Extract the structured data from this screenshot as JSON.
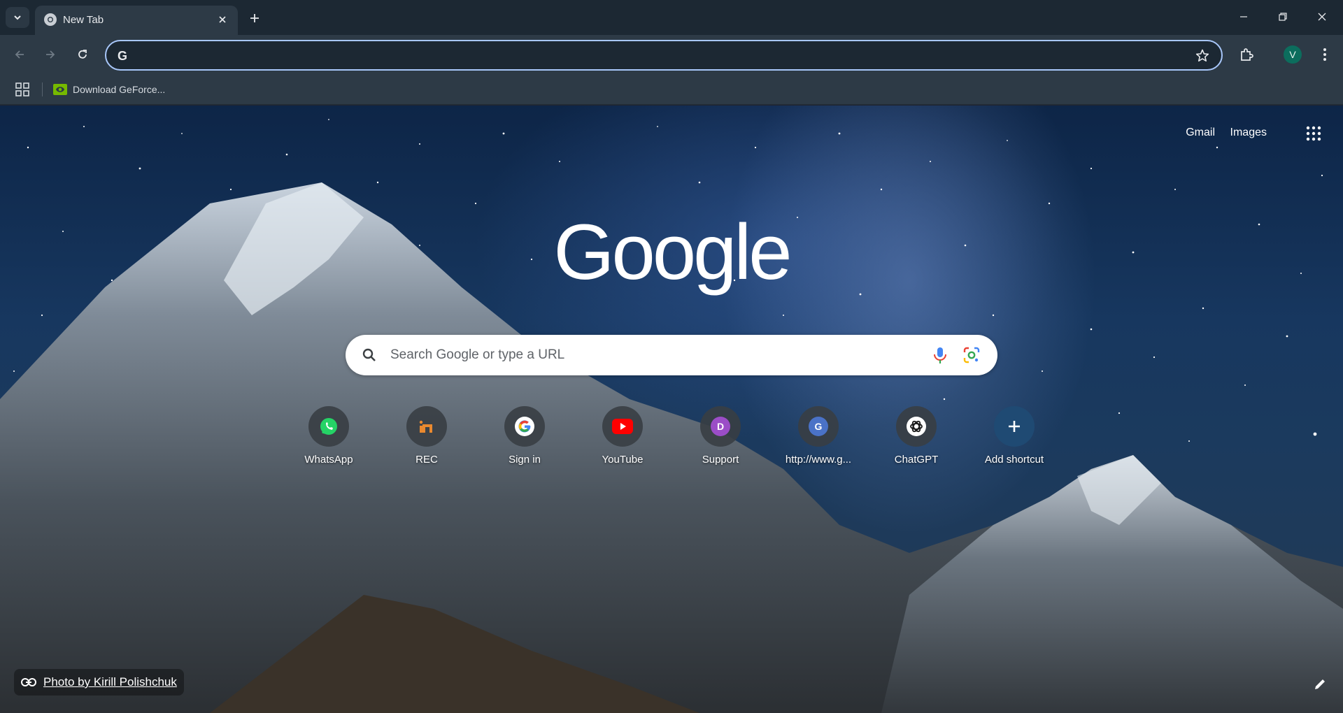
{
  "browser": {
    "tab": {
      "title": "New Tab"
    },
    "omnibox": {
      "value": "",
      "placeholder": ""
    },
    "profile": {
      "initial": "V"
    },
    "bookmarks": [
      {
        "label": "Download GeForce..."
      }
    ]
  },
  "ntp": {
    "top_links": {
      "gmail": "Gmail",
      "images": "Images"
    },
    "search": {
      "placeholder": "Search Google or type a URL"
    },
    "shortcuts": [
      {
        "label": "WhatsApp",
        "icon": "whatsapp-icon"
      },
      {
        "label": "REC",
        "icon": "rec-icon"
      },
      {
        "label": "Sign in",
        "icon": "google-g-icon"
      },
      {
        "label": "YouTube",
        "icon": "youtube-icon"
      },
      {
        "label": "Support",
        "icon": "letter-d-icon",
        "initial": "D"
      },
      {
        "label": "http://www.g...",
        "icon": "letter-g-icon",
        "initial": "G"
      },
      {
        "label": "ChatGPT",
        "icon": "chatgpt-icon"
      },
      {
        "label": "Add shortcut",
        "icon": "plus-icon"
      }
    ],
    "photo_credit": "Photo by Kirill Polishchuk"
  },
  "colors": {
    "omnibox_focus": "#a8c7fa",
    "toolbar": "#2d3a46",
    "tabstrip": "#1c2833",
    "avatar": "#0c6d5d"
  }
}
